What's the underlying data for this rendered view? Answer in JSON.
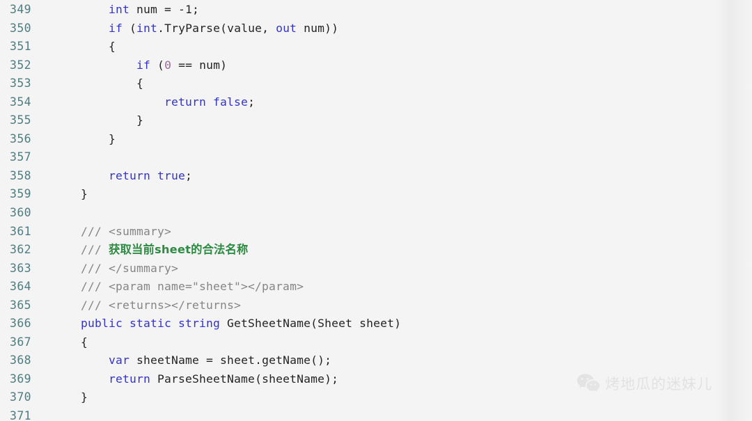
{
  "editor": {
    "background_color": "#f4f4f4",
    "lineno_color": "#4e7d81",
    "keyword_color": "#3333cc",
    "comment_color": "#858585",
    "chinese_comment_color": "#2e8b43",
    "number_color": "#9b6b99",
    "plain_text_color": "#232323",
    "first_line_number": "349",
    "last_line_number": "371",
    "lines": [
      {
        "number": "349",
        "tokens": [
          {
            "t": "    ",
            "c": "plain"
          },
          {
            "t": "int",
            "c": "kw"
          },
          {
            "t": " num = -1;",
            "c": "plain"
          }
        ]
      },
      {
        "number": "350",
        "tokens": [
          {
            "t": "    ",
            "c": "plain"
          },
          {
            "t": "if",
            "c": "kw"
          },
          {
            "t": " (",
            "c": "plain"
          },
          {
            "t": "int",
            "c": "kw"
          },
          {
            "t": ".TryParse(value, ",
            "c": "plain"
          },
          {
            "t": "out",
            "c": "kw"
          },
          {
            "t": " num))",
            "c": "plain"
          }
        ]
      },
      {
        "number": "351",
        "tokens": [
          {
            "t": "    {",
            "c": "plain"
          }
        ]
      },
      {
        "number": "352",
        "tokens": [
          {
            "t": "        ",
            "c": "plain"
          },
          {
            "t": "if",
            "c": "kw"
          },
          {
            "t": " (",
            "c": "plain"
          },
          {
            "t": "0",
            "c": "num"
          },
          {
            "t": " == num)",
            "c": "plain"
          }
        ]
      },
      {
        "number": "353",
        "tokens": [
          {
            "t": "        {",
            "c": "plain"
          }
        ]
      },
      {
        "number": "354",
        "tokens": [
          {
            "t": "            ",
            "c": "plain"
          },
          {
            "t": "return false",
            "c": "kw"
          },
          {
            "t": ";",
            "c": "plain"
          }
        ]
      },
      {
        "number": "355",
        "tokens": [
          {
            "t": "        }",
            "c": "plain"
          }
        ]
      },
      {
        "number": "356",
        "tokens": [
          {
            "t": "    }",
            "c": "plain"
          }
        ]
      },
      {
        "number": "357",
        "tokens": []
      },
      {
        "number": "358",
        "tokens": [
          {
            "t": "    ",
            "c": "plain"
          },
          {
            "t": "return true",
            "c": "kw"
          },
          {
            "t": ";",
            "c": "plain"
          }
        ]
      },
      {
        "number": "359",
        "tokens": [
          {
            "t": "}",
            "c": "plain"
          }
        ]
      },
      {
        "number": "360",
        "tokens": []
      },
      {
        "number": "361",
        "tokens": [
          {
            "t": "/// <summary>",
            "c": "comment"
          }
        ]
      },
      {
        "number": "362",
        "tokens": [
          {
            "t": "/// ",
            "c": "comment"
          },
          {
            "t": "获取当前sheet的合法名称",
            "c": "cn"
          }
        ]
      },
      {
        "number": "363",
        "tokens": [
          {
            "t": "/// </summary>",
            "c": "comment"
          }
        ]
      },
      {
        "number": "364",
        "tokens": [
          {
            "t": "/// <param name=\"sheet\"></param>",
            "c": "comment"
          }
        ]
      },
      {
        "number": "365",
        "tokens": [
          {
            "t": "/// <returns></returns>",
            "c": "comment"
          }
        ]
      },
      {
        "number": "366",
        "tokens": [
          {
            "t": "public static string",
            "c": "kw"
          },
          {
            "t": " GetSheetName(Sheet sheet)",
            "c": "plain"
          }
        ]
      },
      {
        "number": "367",
        "tokens": [
          {
            "t": "{",
            "c": "plain"
          }
        ]
      },
      {
        "number": "368",
        "tokens": [
          {
            "t": "    ",
            "c": "plain"
          },
          {
            "t": "var",
            "c": "kw"
          },
          {
            "t": " sheetName = sheet.getName();",
            "c": "plain"
          }
        ]
      },
      {
        "number": "369",
        "tokens": [
          {
            "t": "    ",
            "c": "plain"
          },
          {
            "t": "return",
            "c": "kw"
          },
          {
            "t": " ParseSheetName(sheetName);",
            "c": "plain"
          }
        ]
      },
      {
        "number": "370",
        "tokens": [
          {
            "t": "}",
            "c": "plain"
          }
        ]
      },
      {
        "number": "371",
        "tokens": []
      }
    ]
  },
  "watermark": {
    "icon": "wechat-icon",
    "text": "烤地瓜的迷妹儿",
    "color": "#b9b9b9"
  }
}
